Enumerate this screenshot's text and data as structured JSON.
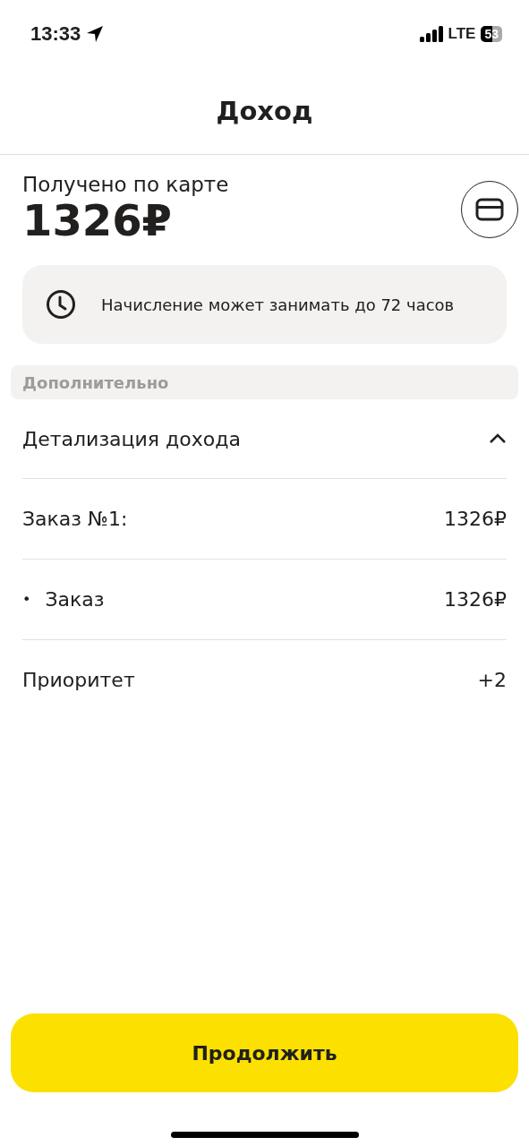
{
  "status_bar": {
    "time": "13:33",
    "network": "LTE",
    "battery": "53"
  },
  "header": {
    "title": "Доход"
  },
  "summary": {
    "label": "Получено по карте",
    "amount": "1326₽"
  },
  "notice": {
    "text": "Начисление может занимать до 72 часов"
  },
  "section": {
    "title": "Дополнительно"
  },
  "details": {
    "title": "Детализация дохода",
    "expanded": true,
    "rows": [
      {
        "kind": "plain",
        "label": "Заказ №1:",
        "value": "1326₽"
      },
      {
        "kind": "bullet",
        "bullet": "•",
        "label": "Заказ",
        "value": "1326₽"
      },
      {
        "kind": "plain",
        "label": "Приоритет",
        "value": "+2"
      }
    ]
  },
  "continue_button": {
    "label": "Продолжить"
  }
}
